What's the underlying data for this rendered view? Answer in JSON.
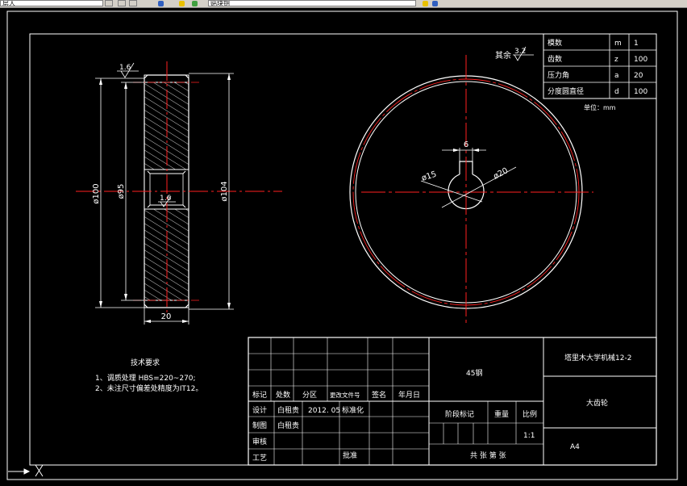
{
  "toolbar": {
    "layer_field": "层人",
    "layer_name": "贴块钥",
    "colors": {
      "toolbar_bg": "#d4d0c8",
      "blue_icon": "#3060c0",
      "yellow_icon": "#e8c000",
      "green_icon": "#40a040"
    }
  },
  "drawing": {
    "colors": {
      "line": "#ffffff",
      "center": "#ff2020",
      "dim": "#ffffff",
      "background": "#000000"
    },
    "side_view": {
      "roughness_left": "1.6",
      "roughness_center": "1.6",
      "dim_outer_left": "ø100",
      "dim_inner_left": "ø95",
      "dim_right": "ø104",
      "dim_width": "20"
    },
    "front_view": {
      "roughness_note": "其余",
      "roughness_value": "3.2",
      "keyway_width": "6",
      "bore_label": "ø15",
      "hub_label": "ø20"
    },
    "param_table": {
      "rows": [
        {
          "name": "模数",
          "symbol": "m",
          "value": "1"
        },
        {
          "name": "齿数",
          "symbol": "z",
          "value": "100"
        },
        {
          "name": "压力角",
          "symbol": "a",
          "value": "20"
        },
        {
          "name": "分度圆直径",
          "symbol": "d",
          "value": "100"
        }
      ],
      "unit_note": "单位：mm"
    },
    "tech_req": {
      "title": "技术要求",
      "line1": "1、调质处理 HBS=220~270;",
      "line2": "2、未注尺寸偏差处精度为IT12。"
    },
    "title_block": {
      "material": "45钢",
      "school": "塔里木大学机械12-2",
      "part_name": "大齿轮",
      "headers": {
        "mark": "标记",
        "count": "处数",
        "zone": "分区",
        "doc_no": "更改文件号",
        "sign": "签名",
        "date": "年月日"
      },
      "design_label": "设计",
      "designer": "白租贵",
      "design_date": "2012. 05",
      "standard_label": "标准化",
      "draw_label": "制图",
      "drawer": "白租贵",
      "review_label": "审核",
      "process_label": "工艺",
      "approve_label": "批准",
      "stage_label": "阶段标记",
      "weight_label": "重量",
      "scale_label": "比例",
      "scale_value": "1:1",
      "sheet_label": "共 张 第 张",
      "paper_size": "A4"
    }
  }
}
